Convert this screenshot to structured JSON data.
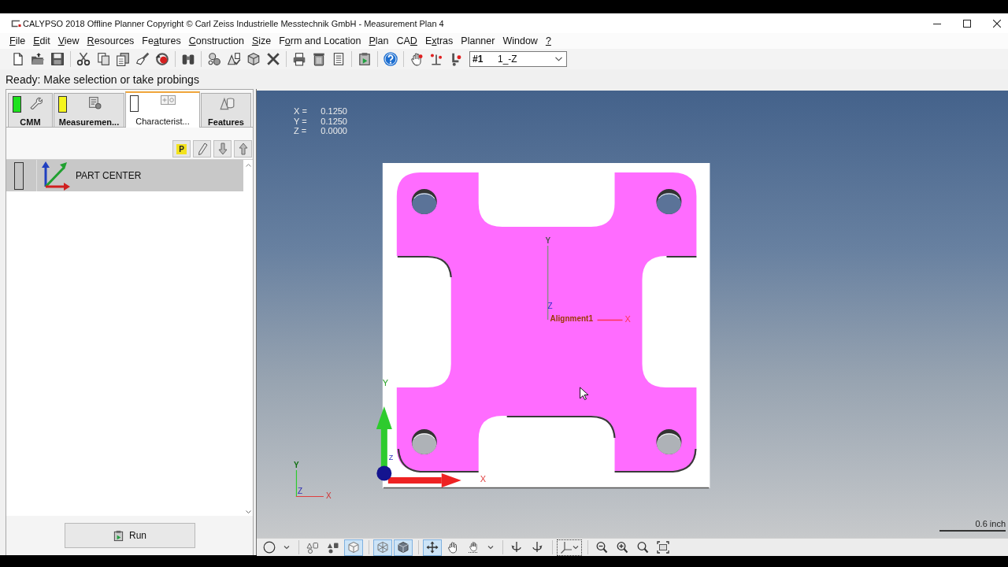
{
  "window": {
    "title": "CALYPSO 2018 Offline Planner Copyright © Carl Zeiss Industrielle Messtechnik GmbH - Measurement Plan 4"
  },
  "menu": [
    {
      "key": "F",
      "post": "ile"
    },
    {
      "key": "E",
      "post": "dit"
    },
    {
      "key": "V",
      "post": "iew"
    },
    {
      "key": "R",
      "post": "esources"
    },
    {
      "pre": "Fe",
      "key": "a",
      "post": "tures"
    },
    {
      "key": "C",
      "post": "onstruction"
    },
    {
      "key": "S",
      "post": "ize"
    },
    {
      "pre": "F",
      "key": "o",
      "post": "rm and Location"
    },
    {
      "key": "P",
      "post": "lan"
    },
    {
      "pre": "CA",
      "key": "D"
    },
    {
      "pre": "E",
      "key": "x",
      "post": "tras"
    },
    {
      "pre": "Planner"
    },
    {
      "pre": "Window"
    },
    {
      "key": "?"
    }
  ],
  "toolbar": {
    "plan_selector": {
      "number": "#1",
      "name": "1_-Z"
    }
  },
  "status_message": "Ready: Make selection or take probings",
  "left_panel": {
    "tabs": [
      {
        "label": "CMM",
        "selected": false,
        "color": "#1ee21e"
      },
      {
        "label": "Measuremen...",
        "selected": false,
        "color": "#f5f51e"
      },
      {
        "label": "Characterist...",
        "selected": true,
        "color": "#ffffff"
      },
      {
        "label": "Features",
        "selected": false
      }
    ],
    "list_toolbar": {
      "p_button": "P"
    },
    "items": [
      {
        "label": "PART CENTER",
        "selected": true,
        "color": "#c4c4c4"
      }
    ],
    "run_button": "Run"
  },
  "viewport": {
    "readout": [
      {
        "label": "X =",
        "value": "0.1250"
      },
      {
        "label": "Y =",
        "value": "0.1250"
      },
      {
        "label": "Z =",
        "value": "0.0000"
      }
    ],
    "part_axes": {
      "y": "Y",
      "z": "Z",
      "name": "Alignment1",
      "x": "X"
    },
    "origin_triad": {
      "y": "Y",
      "z": "Z",
      "x": "X"
    },
    "view_triad": {
      "y": "Y",
      "z": "Z",
      "x": "X"
    },
    "scale": "0.6 inch"
  },
  "view_toolbar": {
    "groups": [
      {
        "buttons": [
          {
            "kind": "circle",
            "selected": false,
            "focused": false
          },
          {
            "kind": "dropdown",
            "selected": false,
            "focused": false
          }
        ]
      },
      {
        "buttons": [
          {
            "kind": "outline",
            "selected": false,
            "focused": false
          },
          {
            "kind": "shapes",
            "selected": false,
            "focused": false
          },
          {
            "kind": "cube",
            "selected": true,
            "focused": false
          }
        ]
      },
      {
        "buttons": [
          {
            "kind": "wireframe",
            "selected": true,
            "focused": false
          },
          {
            "kind": "solid",
            "selected": true,
            "focused": false
          }
        ]
      },
      {
        "buttons": [
          {
            "kind": "move",
            "selected": true,
            "focused": false
          },
          {
            "kind": "hand",
            "selected": false,
            "focused": false
          },
          {
            "kind": "orbit",
            "selected": false,
            "focused": false
          },
          {
            "kind": "dropdown",
            "selected": false,
            "focused": false
          }
        ]
      },
      {
        "buttons": [
          {
            "kind": "tiltleft",
            "selected": false,
            "focused": false
          },
          {
            "kind": "tiltright",
            "selected": false,
            "focused": false
          }
        ]
      },
      {
        "buttons": [
          {
            "kind": "axes",
            "selected": false,
            "focused": true
          }
        ]
      },
      {
        "buttons": [
          {
            "kind": "zoomout",
            "selected": false,
            "focused": false
          },
          {
            "kind": "zoomin",
            "selected": false,
            "focused": false
          },
          {
            "kind": "zoom",
            "selected": false,
            "focused": false
          },
          {
            "kind": "fit",
            "selected": false,
            "focused": false
          }
        ]
      }
    ]
  }
}
